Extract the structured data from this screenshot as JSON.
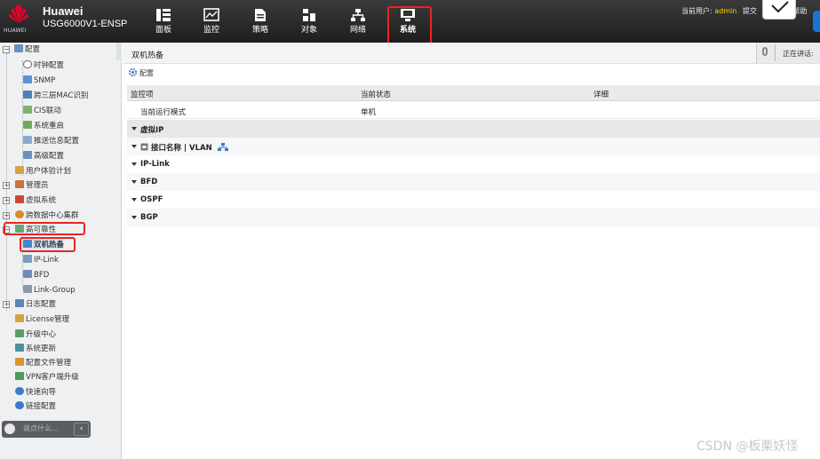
{
  "header": {
    "logo_text": "HUAWEI",
    "brand": "Huawei",
    "model": "USG6000V1-ENSP",
    "nav": [
      {
        "label": "面板",
        "icon": "dashboard-icon"
      },
      {
        "label": "监控",
        "icon": "monitor-icon"
      },
      {
        "label": "策略",
        "icon": "policy-icon"
      },
      {
        "label": "对象",
        "icon": "object-icon"
      },
      {
        "label": "网络",
        "icon": "network-icon"
      },
      {
        "label": "系统",
        "icon": "system-icon",
        "active": true
      }
    ],
    "user_label": "当前用户:",
    "user_name": "admin",
    "submit_label": "提交",
    "help_label": "帮助"
  },
  "sidebar": {
    "items": [
      {
        "label": "配置",
        "icon": "config-icon"
      },
      {
        "label": "时钟配置",
        "icon": "clock-icon"
      },
      {
        "label": "SNMP",
        "icon": "snmp-icon"
      },
      {
        "label": "跨三层MAC识别",
        "icon": "mac-icon"
      },
      {
        "label": "CIS联动",
        "icon": "cis-icon"
      },
      {
        "label": "系统重启",
        "icon": "restart-icon"
      },
      {
        "label": "推送信息配置",
        "icon": "push-icon"
      },
      {
        "label": "高级配置",
        "icon": "advanced-icon"
      },
      {
        "label": "用户体验计划",
        "icon": "ux-icon"
      },
      {
        "label": "管理员",
        "icon": "admin-icon"
      },
      {
        "label": "虚拟系统",
        "icon": "vsys-icon"
      },
      {
        "label": "跨数据中心集群",
        "icon": "cluster-icon"
      },
      {
        "label": "高可靠性",
        "icon": "ha-icon"
      },
      {
        "label": "双机热备",
        "icon": "hot-standby-icon"
      },
      {
        "label": "IP-Link",
        "icon": "iplink-icon"
      },
      {
        "label": "BFD",
        "icon": "bfd-icon"
      },
      {
        "label": "Link-Group",
        "icon": "linkgroup-icon"
      },
      {
        "label": "日志配置",
        "icon": "log-icon"
      },
      {
        "label": "License管理",
        "icon": "license-icon"
      },
      {
        "label": "升级中心",
        "icon": "upgrade-icon"
      },
      {
        "label": "系统更新",
        "icon": "update-icon"
      },
      {
        "label": "配置文件管理",
        "icon": "file-icon"
      },
      {
        "label": "VPN客户端升级",
        "icon": "vpn-icon"
      },
      {
        "label": "快速向导",
        "icon": "wizard-icon"
      },
      {
        "label": "链接配置",
        "icon": "link-icon"
      }
    ],
    "chat_placeholder": "说点什么...",
    "collapse_glyph": "‹"
  },
  "main": {
    "title": "双机热备",
    "online_label": "正在讲话:",
    "config_label": "配置",
    "columns": [
      "监控项",
      "当前状态",
      "详细"
    ],
    "rows": [
      {
        "item": "当前运行模式",
        "status": "单机",
        "detail": ""
      }
    ],
    "groups": [
      "虚拟IP",
      "接口名称 | VLAN",
      "IP-Link",
      "BFD",
      "OSPF",
      "BGP"
    ]
  },
  "watermark": "CSDN @板栗妖怪",
  "colors": {
    "topbar": "#2a2a2a",
    "accent_red": "#e22222",
    "highlight_blue": "#1a73d9"
  }
}
